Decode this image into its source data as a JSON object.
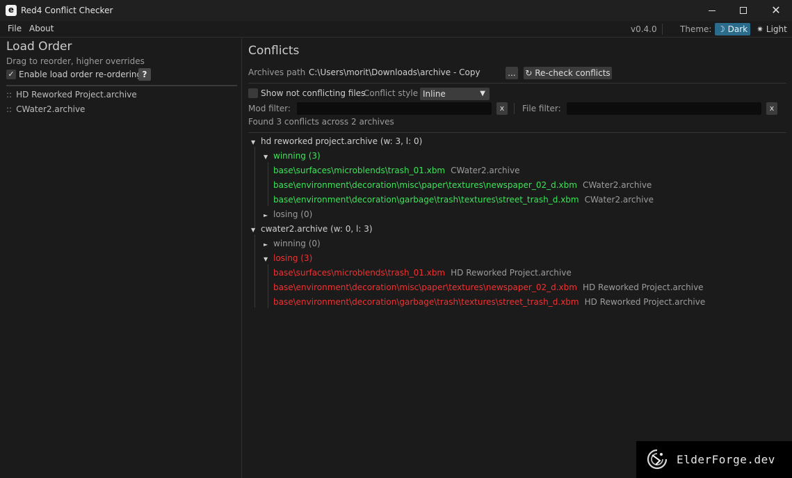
{
  "window": {
    "title": "Red4 Conflict Checker",
    "icon_letter": "e"
  },
  "menu": {
    "file": "File",
    "about": "About",
    "version": "v0.4.0",
    "theme_label": "Theme:",
    "theme_dark": "Dark",
    "theme_light": "Light"
  },
  "load_order": {
    "title": "Load Order",
    "subtitle": "Drag to reorder, higher overrides",
    "enable_label": "Enable load order re-ordering",
    "enable_checked": true,
    "help": "?",
    "items": [
      "HD Reworked Project.archive",
      "CWater2.archive"
    ],
    "drag_glyph": "::"
  },
  "conflicts": {
    "title": "Conflicts",
    "archives_path_label": "Archives path",
    "archives_path": "C:\\Users\\morit\\Downloads\\archive - Copy",
    "browse_label": "...",
    "recheck_label": "Re-check conflicts",
    "show_not_conflicting_label": "Show not conflicting files",
    "show_not_conflicting_checked": false,
    "conflict_style_label": "Conflict style",
    "conflict_style_value": "Inline",
    "mod_filter_label": "Mod filter:",
    "mod_filter_value": "",
    "file_filter_label": "File filter:",
    "file_filter_value": "",
    "clear_label": "x",
    "summary": "Found 3 conflicts across 2 archives",
    "archives": [
      {
        "header": "hd reworked project.archive (w: 3, l: 0)",
        "winning_label": "winning (3)",
        "winning": [
          {
            "path": "base\\surfaces\\microblends\\trash_01.xbm",
            "other": "CWater2.archive"
          },
          {
            "path": "base\\environment\\decoration\\misc\\paper\\textures\\newspaper_02_d.xbm",
            "other": "CWater2.archive"
          },
          {
            "path": "base\\environment\\decoration\\garbage\\trash\\textures\\street_trash_d.xbm",
            "other": "CWater2.archive"
          }
        ],
        "losing_label": "losing (0)"
      },
      {
        "header": "cwater2.archive (w: 0, l: 3)",
        "winning_label": "winning (0)",
        "losing_label": "losing (3)",
        "losing": [
          {
            "path": "base\\surfaces\\microblends\\trash_01.xbm",
            "other": "HD Reworked Project.archive"
          },
          {
            "path": "base\\environment\\decoration\\misc\\paper\\textures\\newspaper_02_d.xbm",
            "other": "HD Reworked Project.archive"
          },
          {
            "path": "base\\environment\\decoration\\garbage\\trash\\textures\\street_trash_d.xbm",
            "other": "HD Reworked Project.archive"
          }
        ]
      }
    ]
  },
  "watermark": {
    "text": "ElderForge.dev"
  },
  "icons": {
    "expanded": "▼",
    "collapsed": "►",
    "check": "✓",
    "moon": "☽",
    "sun": "✷",
    "refresh": "↻",
    "dropdown": "▼",
    "close": "✕"
  },
  "colors": {
    "winning": "#3ee35a",
    "losing": "#f03232",
    "accent": "#2b6c8c"
  }
}
